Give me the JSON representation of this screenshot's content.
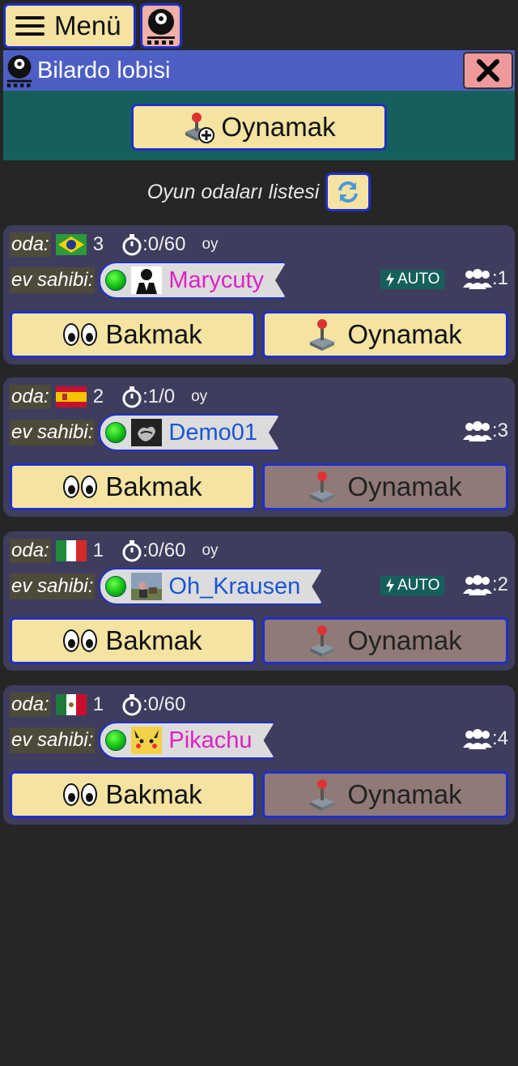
{
  "header": {
    "menu_label": "Menü"
  },
  "lobby": {
    "title": "Bilardo lobisi",
    "play_label": "Oynamak"
  },
  "list": {
    "title": "Oyun odaları listesi"
  },
  "labels": {
    "room": "oda:",
    "host": "ev sahibi:",
    "watch": "Bakmak",
    "play": "Oynamak",
    "auto": "AUTO",
    "vote": "oy"
  },
  "rooms": [
    {
      "flag": "brazil",
      "number": "3",
      "timer": ":0/60",
      "vote": "oy",
      "host": "Marycuty",
      "host_color": "#e020c8",
      "auto": true,
      "players": ":1",
      "play_enabled": true
    },
    {
      "flag": "spain",
      "number": "2",
      "timer": ":1/0",
      "vote": "oy",
      "host": "Demo01",
      "host_color": "#1a55d8",
      "auto": false,
      "players": ":3",
      "play_enabled": false
    },
    {
      "flag": "italy",
      "number": "1",
      "timer": ":0/60",
      "vote": "oy",
      "host": "Oh_Krausen",
      "host_color": "#1a55d8",
      "auto": true,
      "players": ":2",
      "play_enabled": false
    },
    {
      "flag": "mexico",
      "number": "1",
      "timer": ":0/60",
      "vote": "",
      "host": "Pikachu",
      "host_color": "#e020c8",
      "auto": false,
      "players": ":4",
      "play_enabled": false
    }
  ],
  "colors": {
    "button_bg": "#f4e3a1",
    "button_border": "#1f2fc8",
    "lobby_header": "#4d5fc4",
    "lobby_body": "#16605c",
    "room_card": "#3f3d5e",
    "disabled_button": "#8f7a78"
  }
}
